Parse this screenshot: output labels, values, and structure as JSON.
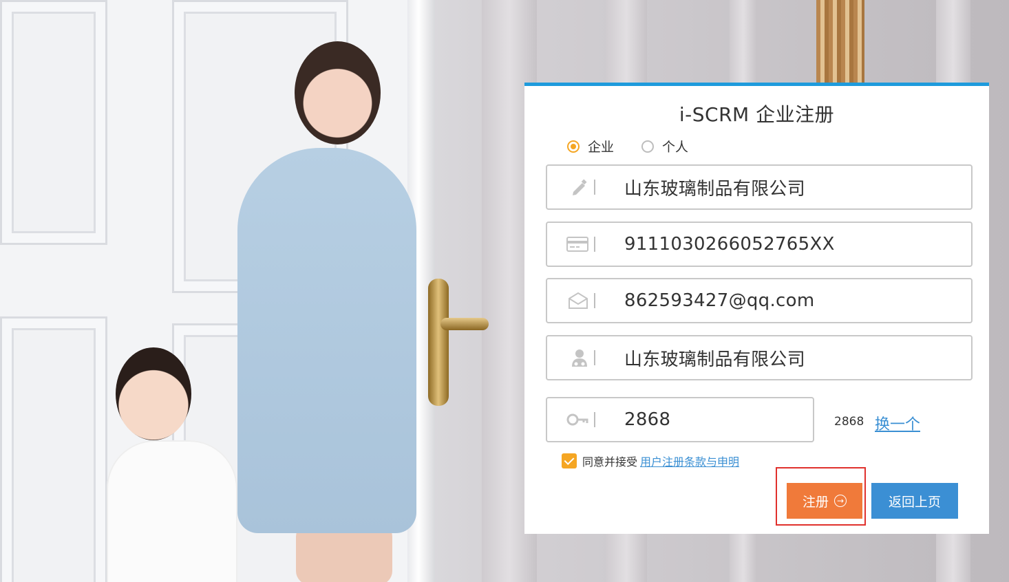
{
  "form": {
    "title": "i-SCRM 企业注册",
    "account_types": [
      {
        "label": "企业",
        "selected": true
      },
      {
        "label": "个人",
        "selected": false
      }
    ],
    "fields": {
      "company_name": {
        "value": "山东玻璃制品有限公司",
        "icon": "pencil-icon"
      },
      "credit_code": {
        "value": "9111030266052765XX",
        "icon": "card-icon"
      },
      "email": {
        "value": "862593427@qq.com",
        "icon": "envelope-icon"
      },
      "contact": {
        "value": "山东玻璃制品有限公司",
        "icon": "user-icon"
      },
      "captcha": {
        "value": "2868",
        "icon": "key-icon"
      }
    },
    "captcha_display": "2868",
    "captcha_refresh": "换一个",
    "agree_text": "同意并接受",
    "agree_link": "用户注册条款与申明",
    "agree_checked": true,
    "register_label": "注册",
    "back_label": "返回上页"
  },
  "colors": {
    "accent_top_bar": "#1e9bdc",
    "radio_checkbox": "#f5a623",
    "register_button": "#f07a3a",
    "back_button": "#3b8fd4",
    "link": "#3a8fd3",
    "highlight": "#e0302c"
  }
}
